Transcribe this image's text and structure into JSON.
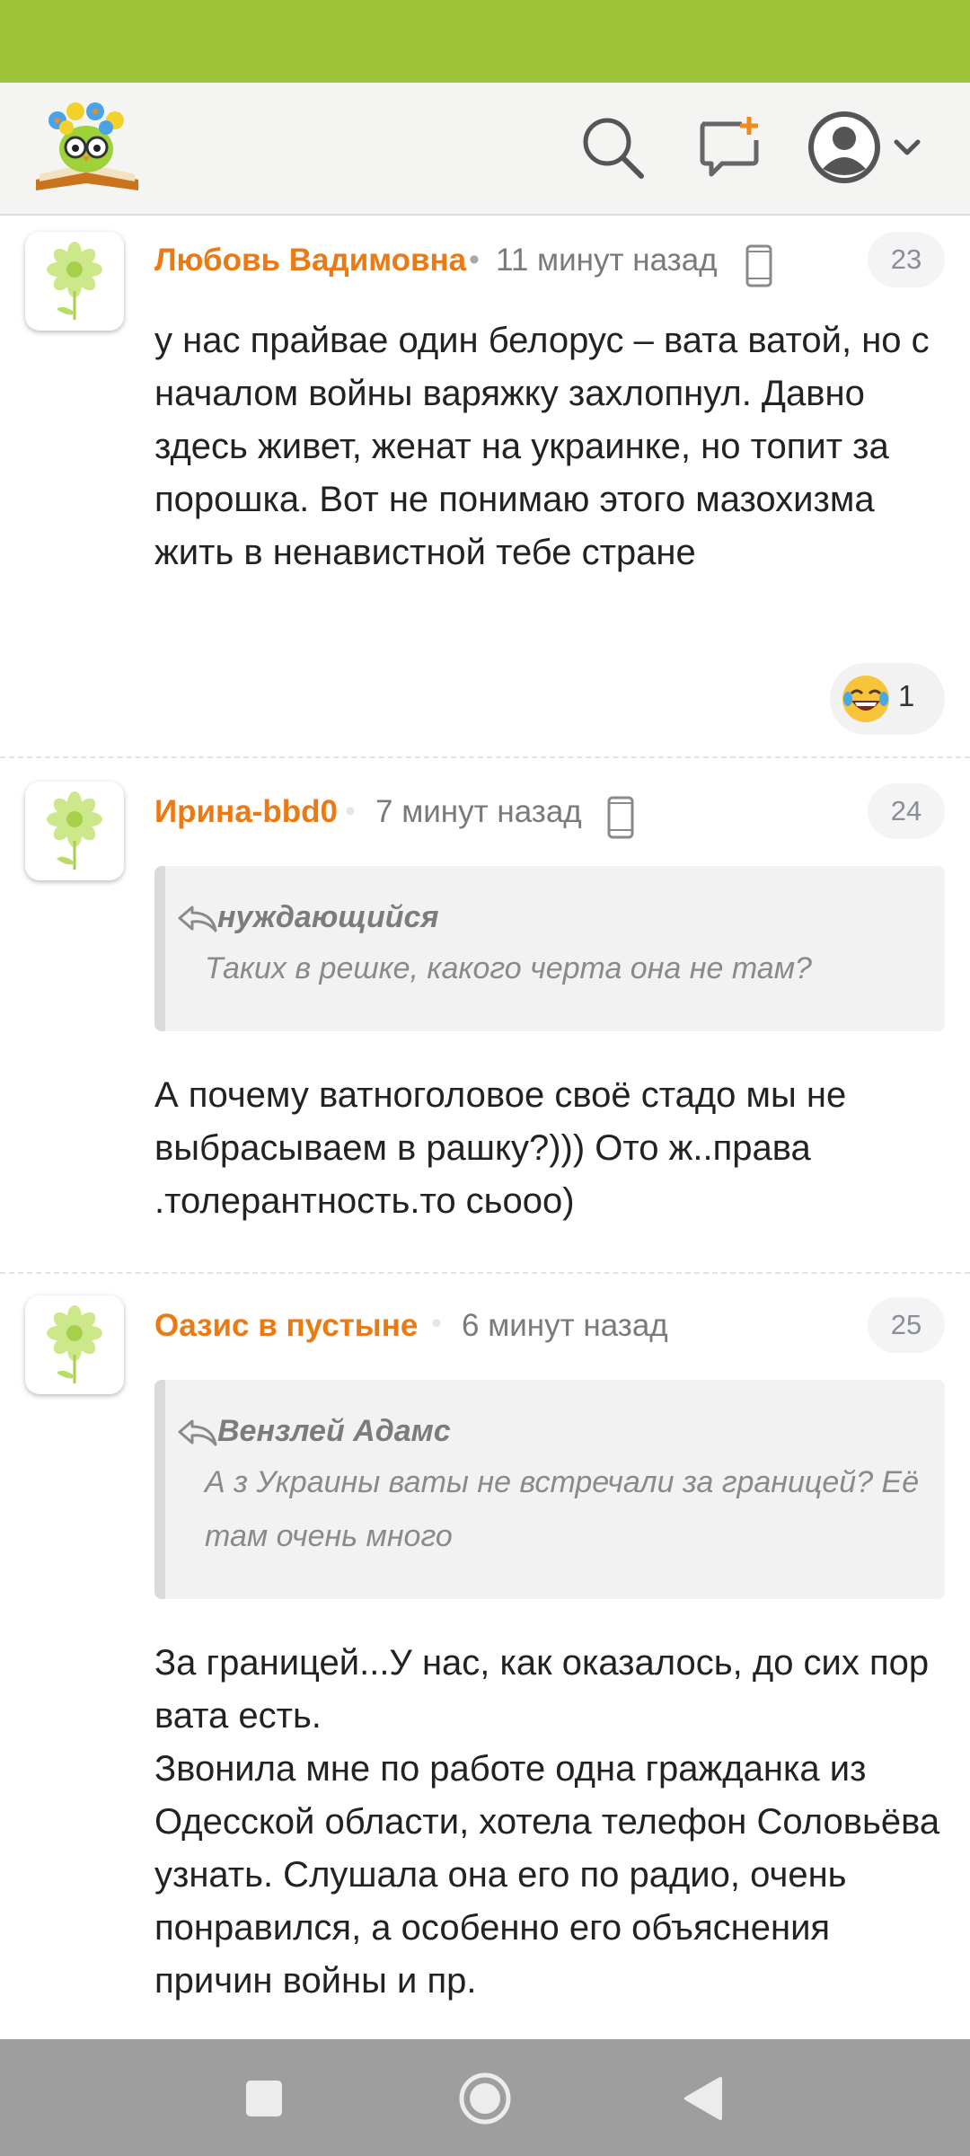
{
  "header": {
    "logo": "owl-reading-book-logo",
    "icons": [
      "search-icon",
      "new-post-icon",
      "profile-avatar-icon",
      "chevron-down-icon"
    ],
    "accent": "#9fc43a"
  },
  "comments": [
    {
      "author": "Любовь Вадимовна",
      "time": "11 минут назад",
      "number": "23",
      "text": "у нас прайвае один белорус – вата ватой, но с началом войны варяжку захлопнул. Давно здесь живет, женат на украинке, но топит за порошка. Вот не понимаю этого мазохизма жить в ненавистной тебе стране",
      "reaction": {
        "emoji": "😂",
        "count": "1"
      }
    },
    {
      "author": "Ирина-bbd0",
      "time": "7 минут назад",
      "number": "24",
      "quote": {
        "author": "нуждающийся",
        "text": "Таких в решке, какого черта она не там?"
      },
      "text": "А почему ватноголовое своё стадо мы не выбрасываем в рашку?))) Ото ж..права .толерантность.то сьооо)"
    },
    {
      "author": "Оазис в пустыне",
      "time": "6 минут назад",
      "number": "25",
      "quote": {
        "author": "Вензлей Адамс",
        "text": "А з Украины ваты не встречали за границей? Её там очень много"
      },
      "text_paragraphs": [
        "За границей...У нас, как оказалось, до сих пор вата есть.",
        "Звонила мне по работе одна гражданка из Одесской области, хотела телефон Соловьёва узнать. Слушала она его по радио, очень понравился, а особенно его объяснения причин войны и пр."
      ]
    }
  ],
  "colors": {
    "author": "#ec7a14",
    "status_bar": "#9fc43a",
    "nav_bar": "#9e9e9e"
  },
  "navbar": {
    "buttons": [
      "recent-apps-button",
      "home-button",
      "back-button"
    ]
  }
}
